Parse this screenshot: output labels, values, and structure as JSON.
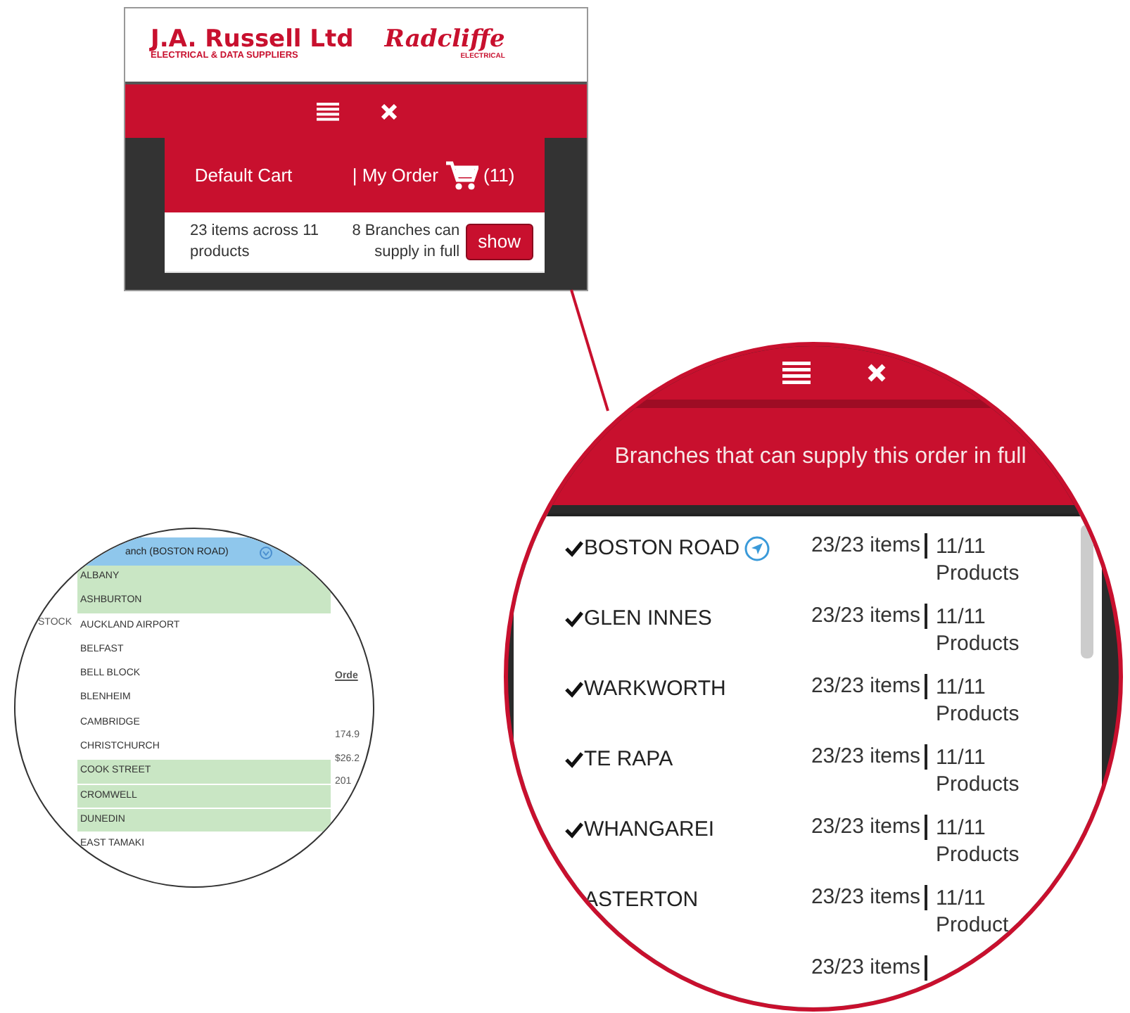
{
  "top_screen": {
    "logo": {
      "name": "J.A. Russell Ltd",
      "tagline": "ELECTRICAL & DATA SUPPLIERS"
    },
    "logo2": {
      "name": "Radcliffe",
      "tagline": "ELECTRICAL"
    },
    "cart": {
      "title": "Default Cart",
      "order": "| My Order",
      "count": "(11)"
    },
    "summary": {
      "items": "23 items across 11 products",
      "branches": "8 Branches can supply in full",
      "button": "show"
    }
  },
  "dropdown_zoom": {
    "selected_branch": "anch (BOSTON ROAD)",
    "branches": [
      {
        "name": "ALBANY",
        "available": true
      },
      {
        "name": "ASHBURTON",
        "available": true
      },
      {
        "name": "AUCKLAND AIRPORT",
        "available": false
      },
      {
        "name": "BELFAST",
        "available": false
      },
      {
        "name": "BELL BLOCK",
        "available": false
      },
      {
        "name": "BLENHEIM",
        "available": false
      },
      {
        "name": "CAMBRIDGE",
        "available": false
      },
      {
        "name": "CHRISTCHURCH",
        "available": false
      },
      {
        "name": "COOK STREET",
        "available": true
      },
      {
        "name": "CROMWELL",
        "available": true
      },
      {
        "name": "DUNEDIN",
        "available": true
      },
      {
        "name": "EAST TAMAKI",
        "available": false
      }
    ],
    "background_texts": [
      "STOCK",
      "Orde",
      "174.9",
      "$26.2",
      "201"
    ]
  },
  "branches_zoom": {
    "title": "Branches that can supply this order in full",
    "rows": [
      {
        "name": "BOSTON ROAD",
        "checked": true,
        "nearest": true,
        "items": "23/23 items",
        "products": "11/11 Products"
      },
      {
        "name": "GLEN INNES",
        "checked": true,
        "nearest": false,
        "items": "23/23 items",
        "products": "11/11 Products"
      },
      {
        "name": "WARKWORTH",
        "checked": true,
        "nearest": false,
        "items": "23/23 items",
        "products": "11/11 Products"
      },
      {
        "name": "TE RAPA",
        "checked": true,
        "nearest": false,
        "items": "23/23 items",
        "products": "11/11 Products"
      },
      {
        "name": "WHANGAREI",
        "checked": true,
        "nearest": false,
        "items": "23/23 items",
        "products": "11/11 Products"
      },
      {
        "name": "ASTERTON",
        "checked": false,
        "nearest": false,
        "items": "23/23 items",
        "products": "11/11 Product"
      },
      {
        "checked": false,
        "nearest": false,
        "items": "23/23 items"
      }
    ]
  }
}
